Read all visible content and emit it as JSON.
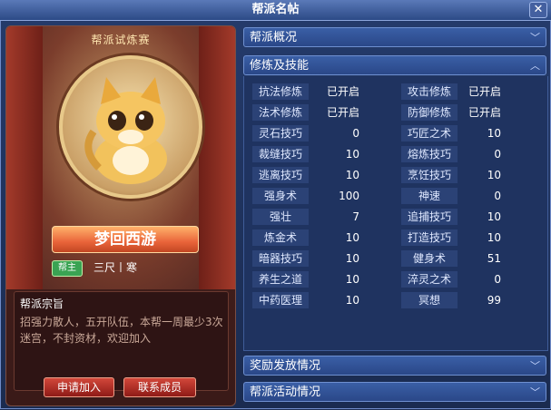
{
  "window": {
    "title": "帮派名帖",
    "close_label": "✕"
  },
  "left_panel": {
    "trial_title": "帮派试炼赛",
    "guild_name": "梦回西游",
    "role_badge": "帮主",
    "rank": "三尺丨寒",
    "motto_title": "帮派宗旨",
    "motto_text": "招强力散人，五开队伍，本帮一周最少3次迷宫，不封资材，欢迎加入",
    "join_button": "申请加入",
    "contact_button": "联系成员"
  },
  "sections": {
    "overview": "帮派概况",
    "cultivation": "修炼及技能",
    "rewards": "奖励发放情况",
    "activity": "帮派活动情况"
  },
  "skills_left": [
    {
      "name": "抗法修炼",
      "value": "已开启"
    },
    {
      "name": "法术修炼",
      "value": "已开启"
    },
    {
      "name": "灵石技巧",
      "value": "0"
    },
    {
      "name": "裁缝技巧",
      "value": "10"
    },
    {
      "name": "逃离技巧",
      "value": "10"
    },
    {
      "name": "强身术",
      "value": "100"
    },
    {
      "name": "强壮",
      "value": "7"
    },
    {
      "name": "炼金术",
      "value": "10"
    },
    {
      "name": "暗器技巧",
      "value": "10"
    },
    {
      "name": "养生之道",
      "value": "10"
    },
    {
      "name": "中药医理",
      "value": "10"
    }
  ],
  "skills_right": [
    {
      "name": "攻击修炼",
      "value": "已开启"
    },
    {
      "name": "防御修炼",
      "value": "已开启"
    },
    {
      "name": "巧匠之术",
      "value": "10"
    },
    {
      "name": "熔炼技巧",
      "value": "0"
    },
    {
      "name": "烹饪技巧",
      "value": "10"
    },
    {
      "name": "神速",
      "value": "0"
    },
    {
      "name": "追捕技巧",
      "value": "10"
    },
    {
      "name": "打造技巧",
      "value": "10"
    },
    {
      "name": "健身术",
      "value": "51"
    },
    {
      "name": "淬灵之术",
      "value": "0"
    },
    {
      "name": "冥想",
      "value": "99"
    }
  ]
}
